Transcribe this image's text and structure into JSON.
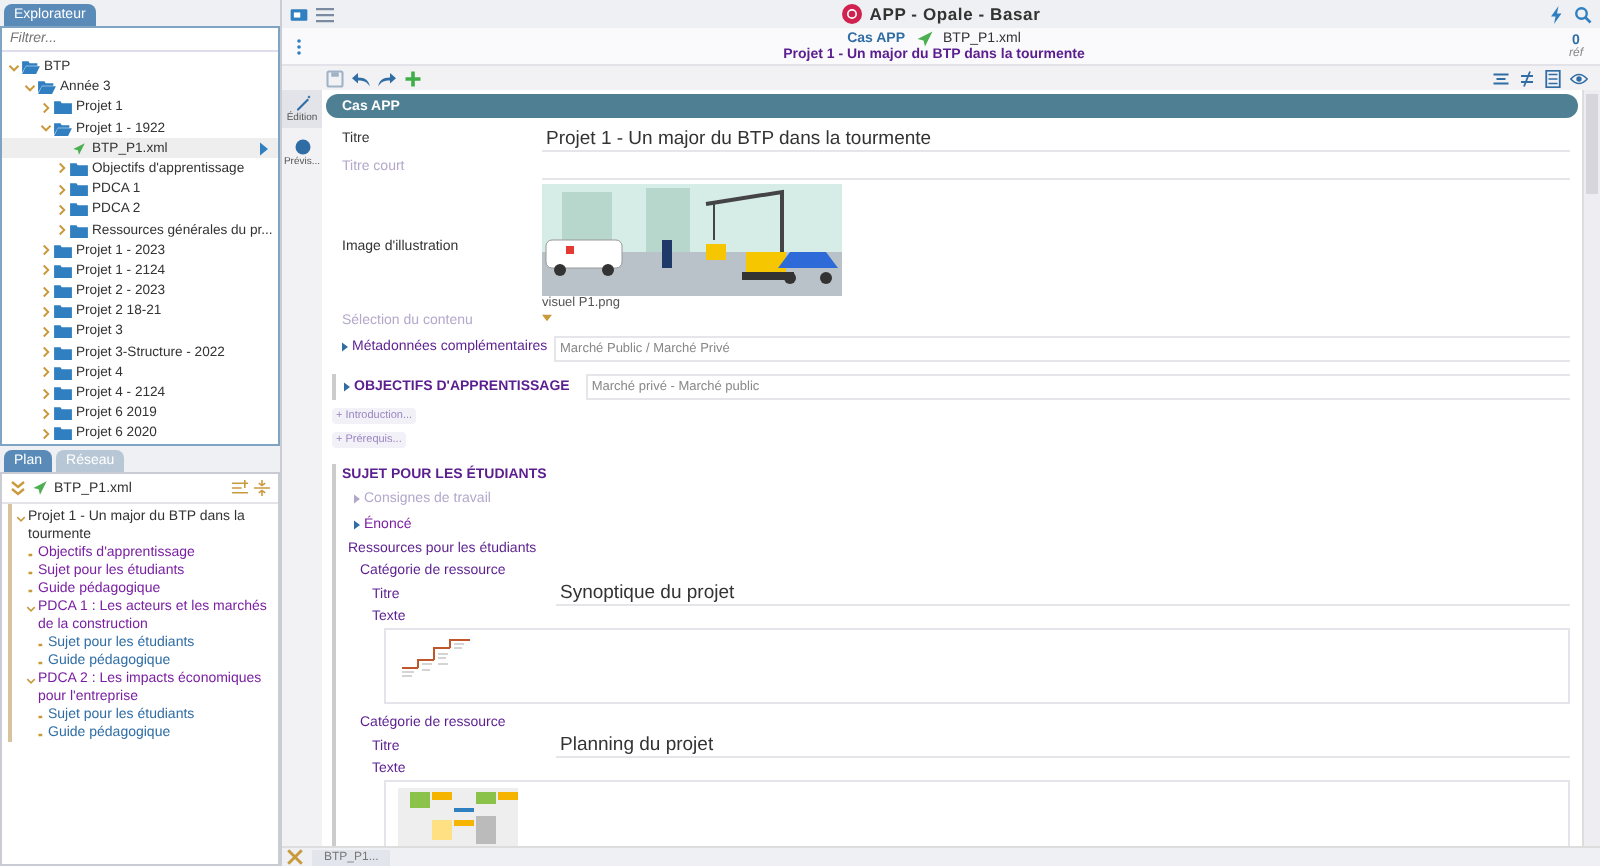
{
  "app_bar": {
    "title": "APP - Opale - Basar"
  },
  "document_bar": {
    "model": "Cas APP",
    "file": "BTP_P1.xml",
    "title": "Projet 1 - Un major du BTP dans la tourmente",
    "ref_count": "0",
    "ref_label": "réf"
  },
  "explorer": {
    "tab": "Explorateur",
    "filter_placeholder": "Filtrer...",
    "tree": [
      {
        "label": "BTP",
        "kind": "folder",
        "expanded": true,
        "selected": false,
        "children": [
          {
            "label": "Année 3",
            "kind": "folder",
            "expanded": true,
            "selected": false,
            "children": [
              {
                "label": "Projet 1",
                "kind": "folder",
                "expanded": false,
                "selected": false
              },
              {
                "label": "Projet 1 - 1922",
                "kind": "folder",
                "expanded": true,
                "selected": false,
                "children": [
                  {
                    "label": "BTP_P1.xml",
                    "kind": "file",
                    "selected": true
                  },
                  {
                    "label": "Objectifs d'apprentissage",
                    "kind": "folder",
                    "expanded": false,
                    "selected": false
                  },
                  {
                    "label": "PDCA 1",
                    "kind": "folder",
                    "expanded": false,
                    "selected": false
                  },
                  {
                    "label": "PDCA 2",
                    "kind": "folder",
                    "expanded": false,
                    "selected": false
                  },
                  {
                    "label": "Ressources générales du pr...",
                    "kind": "folder",
                    "expanded": false,
                    "selected": false
                  }
                ]
              },
              {
                "label": "Projet 1 - 2023",
                "kind": "folder",
                "expanded": false,
                "selected": false
              },
              {
                "label": "Projet 1 - 2124",
                "kind": "folder",
                "expanded": false,
                "selected": false
              },
              {
                "label": "Projet 2 - 2023",
                "kind": "folder",
                "expanded": false,
                "selected": false
              },
              {
                "label": "Projet 2 18-21",
                "kind": "folder",
                "expanded": false,
                "selected": false
              },
              {
                "label": "Projet 3",
                "kind": "folder",
                "expanded": false,
                "selected": false
              },
              {
                "label": "Projet 3-Structure - 2022",
                "kind": "folder",
                "expanded": false,
                "selected": false
              },
              {
                "label": "Projet 4",
                "kind": "folder",
                "expanded": false,
                "selected": false
              },
              {
                "label": "Projet 4 - 2124",
                "kind": "folder",
                "expanded": false,
                "selected": false
              },
              {
                "label": "Projet 6 2019",
                "kind": "folder",
                "expanded": false,
                "selected": false
              },
              {
                "label": "Projet 6 2020",
                "kind": "folder",
                "expanded": false,
                "selected": false
              }
            ]
          }
        ]
      }
    ]
  },
  "lower_tabs": [
    {
      "label": "Plan",
      "selected": true
    },
    {
      "label": "Réseau",
      "selected": false
    }
  ],
  "outline": {
    "file": "BTP_P1.xml",
    "items": [
      {
        "label": "Projet 1 - Un major du BTP dans la tourmente",
        "expanded": true,
        "children": [
          {
            "label": "Objectifs d'apprentissage"
          },
          {
            "label": "Sujet pour les étudiants"
          },
          {
            "label": "Guide pédagogique"
          },
          {
            "label": "PDCA 1 : Les acteurs et les marchés de la construction",
            "expanded": true,
            "children": [
              {
                "label": "Sujet pour les étudiants"
              },
              {
                "label": "Guide pédagogique"
              }
            ]
          },
          {
            "label": "PDCA 2 : Les impacts économiques pour l'entreprise",
            "expanded": true,
            "children": [
              {
                "label": "Sujet pour les étudiants"
              },
              {
                "label": "Guide pédagogique"
              }
            ]
          }
        ]
      }
    ]
  },
  "side_modes": [
    {
      "label": "Édition",
      "selected": true
    },
    {
      "label": "Prévis...",
      "selected": false
    }
  ],
  "editor": {
    "header": "Cas APP",
    "fields": [
      {
        "kind": "text",
        "label": "Titre",
        "value": "Projet 1 - Un major du BTP dans la tourmente",
        "disabled": false
      },
      {
        "kind": "text",
        "label": "Titre court",
        "disabled": true
      },
      {
        "kind": "image",
        "label": "Image d'illustration",
        "caption": "visuel P1.png",
        "disabled": false
      },
      {
        "kind": "select",
        "label": "Sélection du contenu",
        "disabled": true
      },
      {
        "kind": "collapsed",
        "label": "Métadonnées complémentaires",
        "value": "Marché Public / Marché Privé",
        "disabled": false
      }
    ],
    "objectives": {
      "title": "OBJECTIFS D'APPRENTISSAGE",
      "value": "Marché privé - Marché public"
    },
    "add_buttons": [
      "+ Introduction...",
      "+ Prérequis..."
    ],
    "subject": {
      "title": "SUJET POUR LES ÉTUDIANTS",
      "items": [
        {
          "label": "Consignes de travail",
          "disabled": true
        },
        {
          "label": "Énoncé",
          "disabled": false
        }
      ],
      "resources_label": "Ressources pour les étudiants",
      "resources": [
        {
          "category": "Catégorie de ressource",
          "title_label": "Titre",
          "title": "Synoptique du projet",
          "text_label": "Texte",
          "kind": "diagram"
        },
        {
          "category": "Catégorie de ressource",
          "title_label": "Titre",
          "title": "Planning du projet",
          "text_label": "Texte",
          "kind": "table"
        }
      ]
    }
  },
  "bottom_tabs": [
    {
      "label": "BTP_P1...",
      "selected": true
    }
  ]
}
